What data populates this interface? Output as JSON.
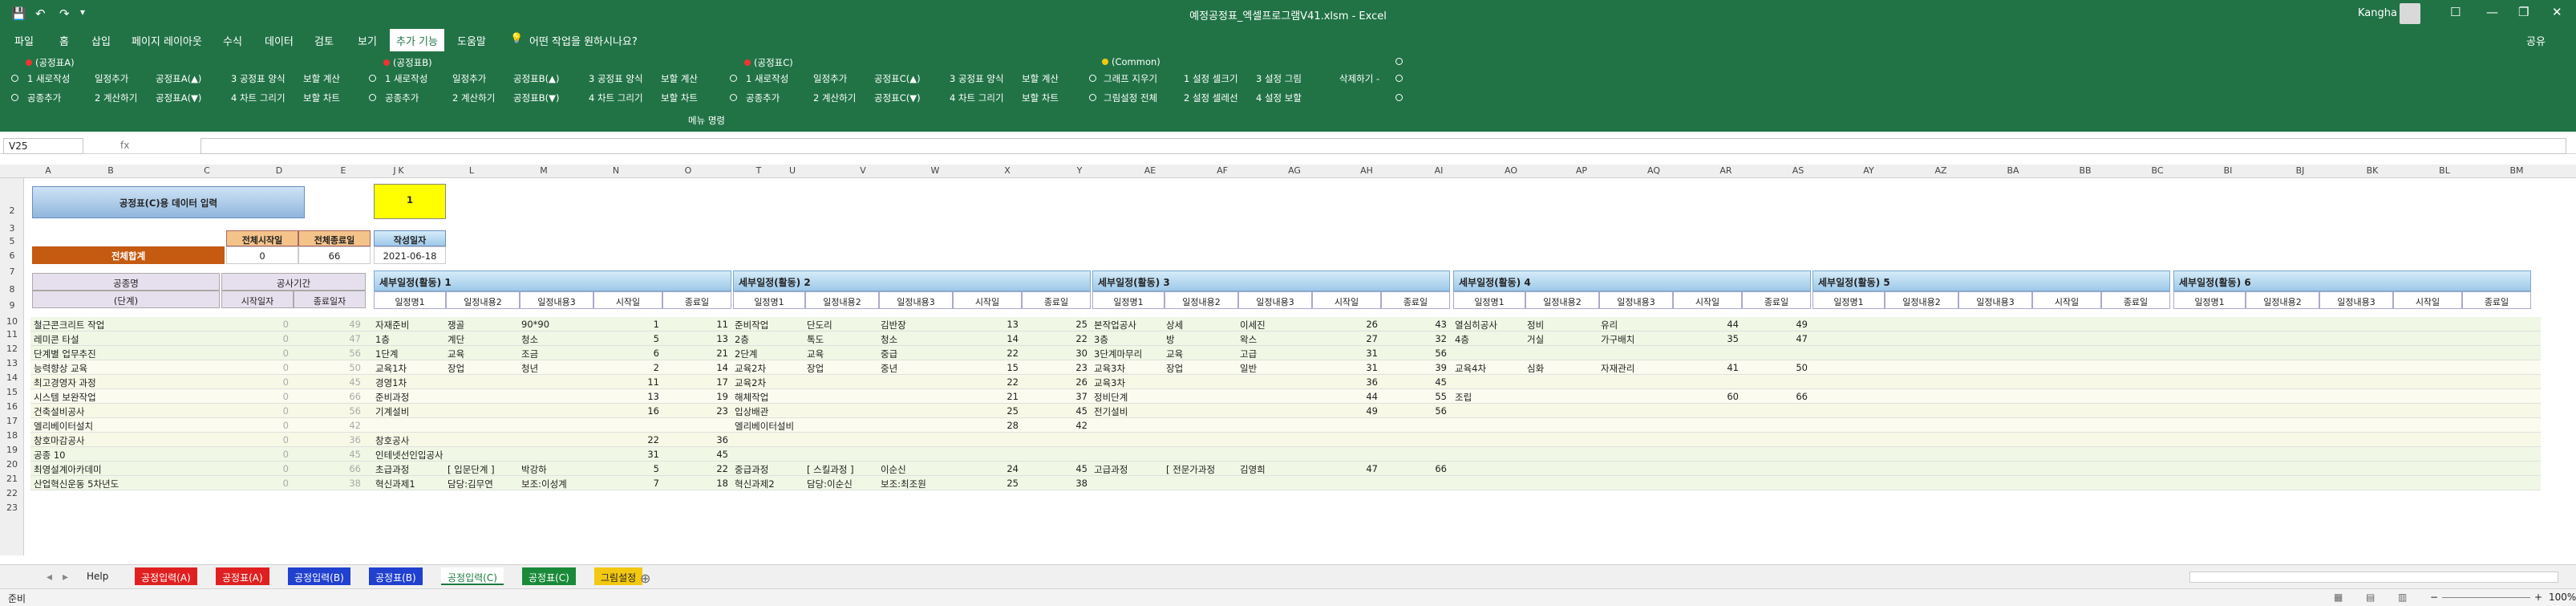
{
  "title_bar": {
    "undo_icon": "undo-icon",
    "title": "예정공정표_엑셀프로그램V41.xlsm  -  Excel",
    "user": "Kangha",
    "save": "💾",
    "restore": "❐",
    "min": "—",
    "close": "✕",
    "max": "☐"
  },
  "tabs": [
    "파일",
    "홈",
    "삽입",
    "페이지 레이아웃",
    "수식",
    "데이터",
    "검토",
    "보기",
    "추가 기능",
    "도움말",
    "어떤 작업을 원하시나요?"
  ],
  "share": "공유",
  "ribbon": {
    "groupA": {
      "title": "(공정표A)",
      "r1": [
        "1 새로작성",
        "일정추가",
        "공정표A(▲)",
        "3 공정표 양식",
        "보할 계산"
      ],
      "r2": [
        "공종추가",
        "2 계산하기",
        "공정표A(▼)",
        "4 차트 그리기",
        "보할 차트"
      ]
    },
    "groupB": {
      "title": "(공정표B)",
      "r1": [
        "1 새로작성",
        "일정추가",
        "공정표B(▲)",
        "3 공정표 양식",
        "보할 계산"
      ],
      "r2": [
        "공종추가",
        "2 계산하기",
        "공정표B(▼)",
        "4 차트 그리기",
        "보할 차트"
      ]
    },
    "groupC": {
      "title": "(공정표C)",
      "r1": [
        "1 새로작성",
        "일정추가",
        "공정표C(▲)",
        "3 공정표 양식",
        "보할 계산"
      ],
      "r2": [
        "공종추가",
        "2 계산하기",
        "공정표C(▼)",
        "4 차트 그리기",
        "보할 차트"
      ]
    },
    "common": {
      "title": "(Common)",
      "r1": [
        "그래프 지우기",
        "1 설정 셀크기",
        "3 설정 그림",
        "삭제하기 -"
      ],
      "r2": [
        "그림설정 전체",
        "2 설정 셀레선",
        "4 설정 보할"
      ]
    },
    "menu_label": "메뉴 명령"
  },
  "formula": {
    "namebox": "V25",
    "fx": "fx"
  },
  "columns": [
    "A",
    "B",
    "C",
    "D",
    "E",
    "J",
    "K",
    "L",
    "M",
    "N",
    "O",
    "T",
    "U",
    "V",
    "W",
    "X",
    "Y",
    "AE",
    "AF",
    "AG",
    "AH",
    "AI",
    "AO",
    "AP",
    "AQ",
    "AR",
    "AS",
    "AY",
    "AZ",
    "BA",
    "BB",
    "BC",
    "BI",
    "BJ",
    "BK",
    "BL",
    "BM"
  ],
  "rows": [
    "2",
    "3",
    "5",
    "6",
    "7",
    "8",
    "9",
    "10",
    "11",
    "12",
    "13",
    "14",
    "15",
    "16",
    "17",
    "18",
    "19",
    "20",
    "21",
    "22",
    "23"
  ],
  "header_block": {
    "title": "공정표(C)용 데이터 입력",
    "one": "1",
    "col_start": "전체시작일",
    "col_end": "전체종료일",
    "total_label": "전체합계",
    "start_val": "0",
    "end_val": "66",
    "date_label": "작성일자",
    "date_val": "2021-06-18"
  },
  "left_headers": {
    "gongjong": "공종명",
    "danwi": "(단계)",
    "period": "공사기간",
    "start": "시작일자",
    "end": "종료일자"
  },
  "sections": [
    "세부일정(활동) 1",
    "세부일정(활동) 2",
    "세부일정(활동) 3",
    "세부일정(활동) 4",
    "세부일정(활동) 5",
    "세부일정(활동) 6"
  ],
  "sub": [
    "일정명1",
    "일정내용2",
    "일정내용3",
    "시작일",
    "종료일"
  ],
  "data_rows": [
    {
      "name": "철근콘크리트 작업",
      "s": "0",
      "e": "49",
      "d": [
        [
          "자재준비",
          "쟁골",
          "90*90",
          "1",
          "11"
        ],
        [
          "준비작업",
          "단도리",
          "김반장",
          "13",
          "25"
        ],
        [
          "본작업공사",
          "상세",
          "이세진",
          "26",
          "43"
        ],
        [
          "열심히공사",
          "정비",
          "유리",
          "44",
          "49"
        ],
        [
          "",
          "",
          "",
          "",
          ""
        ],
        [
          "",
          "",
          "",
          "",
          ""
        ]
      ]
    },
    {
      "name": "레미콘 타설",
      "s": "0",
      "e": "47",
      "d": [
        [
          "1층",
          "계단",
          "청소",
          "5",
          "13"
        ],
        [
          "2층",
          "톡도",
          "청소",
          "14",
          "22"
        ],
        [
          "3층",
          "방",
          "왁스",
          "27",
          "32"
        ],
        [
          "4층",
          "거실",
          "가구배치",
          "35",
          "47"
        ],
        [
          "",
          "",
          "",
          "",
          ""
        ],
        [
          "",
          "",
          "",
          "",
          ""
        ]
      ]
    },
    {
      "name": "단계별 업무추진",
      "s": "0",
      "e": "56",
      "d": [
        [
          "1단계",
          "교육",
          "조금",
          "6",
          "21"
        ],
        [
          "2단계",
          "교육",
          "중급",
          "22",
          "30"
        ],
        [
          "3단계마무리",
          "교육",
          "고급",
          "31",
          "56"
        ],
        [
          "",
          "",
          "",
          "",
          ""
        ],
        [
          "",
          "",
          "",
          "",
          ""
        ],
        [
          "",
          "",
          "",
          "",
          ""
        ]
      ]
    },
    {
      "name": "능력향상 교육",
      "s": "0",
      "e": "50",
      "d": [
        [
          "교육1차",
          "장업",
          "청년",
          "2",
          "14"
        ],
        [
          "교육2차",
          "장업",
          "중년",
          "15",
          "23"
        ],
        [
          "교육3차",
          "장업",
          "일반",
          "31",
          "39"
        ],
        [
          "교육4차",
          "심화",
          "자재관리",
          "41",
          "50"
        ],
        [
          "",
          "",
          "",
          "",
          ""
        ],
        [
          "",
          "",
          "",
          "",
          ""
        ]
      ]
    },
    {
      "name": "최고경영자 과정",
      "s": "0",
      "e": "45",
      "d": [
        [
          "경영1차",
          "",
          "",
          "11",
          "17"
        ],
        [
          "교육2차",
          "",
          "",
          "22",
          "26"
        ],
        [
          "교육3차",
          "",
          "",
          "36",
          "45"
        ],
        [
          "",
          "",
          "",
          "",
          ""
        ],
        [
          "",
          "",
          "",
          "",
          ""
        ],
        [
          "",
          "",
          "",
          "",
          ""
        ]
      ]
    },
    {
      "name": "시스템 보완작업",
      "s": "0",
      "e": "66",
      "d": [
        [
          "준비과정",
          "",
          "",
          "13",
          "19"
        ],
        [
          "해체작업",
          "",
          "",
          "21",
          "37"
        ],
        [
          "정비단계",
          "",
          "",
          "44",
          "55"
        ],
        [
          "조립",
          "",
          "",
          "60",
          "66"
        ],
        [
          "",
          "",
          "",
          "",
          ""
        ],
        [
          "",
          "",
          "",
          "",
          ""
        ]
      ]
    },
    {
      "name": "건축설비공사",
      "s": "0",
      "e": "56",
      "d": [
        [
          "기계설비",
          "",
          "",
          "16",
          "23"
        ],
        [
          "입상배관",
          "",
          "",
          "25",
          "45"
        ],
        [
          "전기설비",
          "",
          "",
          "49",
          "56"
        ],
        [
          "",
          "",
          "",
          "",
          ""
        ],
        [
          "",
          "",
          "",
          "",
          ""
        ],
        [
          "",
          "",
          "",
          "",
          ""
        ]
      ]
    },
    {
      "name": "엘리베이터설치",
      "s": "0",
      "e": "42",
      "d": [
        [
          "",
          "",
          "",
          "",
          ""
        ],
        [
          "엘리베이터설비",
          "",
          "",
          "28",
          "42"
        ],
        [
          "",
          "",
          "",
          "",
          ""
        ],
        [
          "",
          "",
          "",
          "",
          ""
        ],
        [
          "",
          "",
          "",
          "",
          ""
        ],
        [
          "",
          "",
          "",
          "",
          ""
        ]
      ]
    },
    {
      "name": "창호마감공사",
      "s": "0",
      "e": "36",
      "d": [
        [
          "창호공사",
          "",
          "",
          "22",
          "36"
        ],
        [
          "",
          "",
          "",
          "",
          ""
        ],
        [
          "",
          "",
          "",
          "",
          ""
        ],
        [
          "",
          "",
          "",
          "",
          ""
        ],
        [
          "",
          "",
          "",
          "",
          ""
        ],
        [
          "",
          "",
          "",
          "",
          ""
        ]
      ]
    },
    {
      "name": "공종 10",
      "s": "0",
      "e": "45",
      "d": [
        [
          "인테넷선인입공사",
          "",
          "",
          "31",
          "45"
        ],
        [
          "",
          "",
          "",
          "",
          ""
        ],
        [
          "",
          "",
          "",
          "",
          ""
        ],
        [
          "",
          "",
          "",
          "",
          ""
        ],
        [
          "",
          "",
          "",
          "",
          ""
        ],
        [
          "",
          "",
          "",
          "",
          ""
        ]
      ]
    },
    {
      "name": "최영설계아카데미",
      "s": "0",
      "e": "66",
      "d": [
        [
          "초급과정",
          "[ 입문단계 ]",
          "박강하",
          "5",
          "22"
        ],
        [
          "중급과정",
          "[ 스킬과정 ]",
          "이순신",
          "24",
          "45"
        ],
        [
          "고급과정",
          "[ 전문가과정",
          "김영희",
          "47",
          "66"
        ],
        [
          "",
          "",
          "",
          "",
          ""
        ],
        [
          "",
          "",
          "",
          "",
          ""
        ],
        [
          "",
          "",
          "",
          "",
          ""
        ]
      ]
    },
    {
      "name": "산업혁신운동 5차년도",
      "s": "0",
      "e": "38",
      "d": [
        [
          "혁신과제1",
          "담당:김무연",
          "보조:이성계",
          "7",
          "18"
        ],
        [
          "혁신과제2",
          "담당:이순신",
          "보조:최조원",
          "25",
          "38"
        ],
        [
          "",
          "",
          "",
          "",
          ""
        ],
        [
          "",
          "",
          "",
          "",
          ""
        ],
        [
          "",
          "",
          "",
          "",
          ""
        ],
        [
          "",
          "",
          "",
          "",
          ""
        ]
      ]
    }
  ],
  "sheet_tabs": [
    {
      "label": "Help",
      "bg": "#f0f0f0",
      "fg": "#222"
    },
    {
      "label": "공정입력(A)",
      "bg": "#e02020",
      "fg": "#fff"
    },
    {
      "label": "공정표(A)",
      "bg": "#e02020",
      "fg": "#fff"
    },
    {
      "label": "공정입력(B)",
      "bg": "#2040d0",
      "fg": "#fff"
    },
    {
      "label": "공정표(B)",
      "bg": "#2040d0",
      "fg": "#fff"
    },
    {
      "label": "공정입력(C)",
      "bg": "#ffffff",
      "fg": "#1a7a3a"
    },
    {
      "label": "공정표(C)",
      "bg": "#1a8a3a",
      "fg": "#fff"
    },
    {
      "label": "그림설정",
      "bg": "#f2c811",
      "fg": "#222"
    }
  ],
  "status": {
    "ready": "준비",
    "zoom": "100%"
  }
}
